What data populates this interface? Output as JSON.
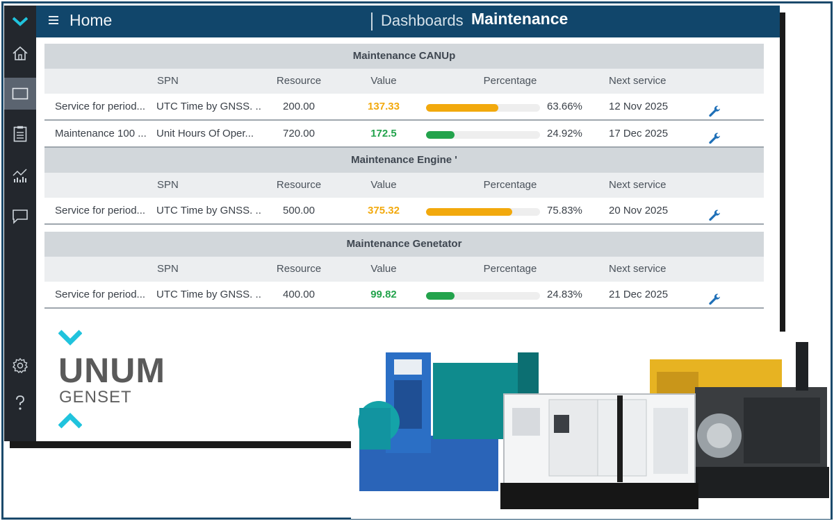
{
  "topbar": {
    "home": "Home",
    "dashboards": "Dashboards",
    "current": "Maintenance"
  },
  "columns": {
    "spn": "SPN",
    "resource": "Resource",
    "value": "Value",
    "percentage": "Percentage",
    "next_service": "Next service"
  },
  "sections": [
    {
      "title": "Maintenance CANUp",
      "rows": [
        {
          "name": "Service for period...",
          "spn": "UTC Time by GNSS. ...",
          "resource": "200.00",
          "value": "137.33",
          "value_status": "orange",
          "percent": 63.66,
          "percent_label": "63.66%",
          "next": "12 Nov 2025"
        },
        {
          "name": "Maintenance 100 ...",
          "spn": "Unit Hours Of Oper...",
          "resource": "720.00",
          "value": "172.5",
          "value_status": "green",
          "percent": 24.92,
          "percent_label": "24.92%",
          "next": "17 Dec 2025"
        }
      ]
    },
    {
      "title": "Maintenance Engine '",
      "rows": [
        {
          "name": "Service for period...",
          "spn": "UTC Time by GNSS. ...",
          "resource": "500.00",
          "value": "375.32",
          "value_status": "orange",
          "percent": 75.83,
          "percent_label": "75.83%",
          "next": "20 Nov 2025"
        }
      ]
    },
    {
      "title": "Maintenance Genetator",
      "rows": [
        {
          "name": "Service for period...",
          "spn": "UTC Time by GNSS. ...",
          "resource": "400.00",
          "value": "99.82",
          "value_status": "green",
          "percent": 24.83,
          "percent_label": "24.83%",
          "next": "21 Dec 2025"
        }
      ]
    }
  ],
  "logo": {
    "word": "UNUM",
    "sub": "GENSET"
  },
  "colors": {
    "topbar": "#11466b",
    "sidebar": "#23272d",
    "orange": "#f2a90d",
    "green": "#23a34c",
    "accent": "#20c3dd",
    "wrench": "#1f70b8"
  },
  "icons": {
    "sidebar": [
      "chevron-down-icon",
      "home-icon",
      "monitor-icon",
      "report-icon",
      "chart-icon",
      "chat-icon",
      "settings-icon",
      "help-icon"
    ],
    "row_action": "wrench-icon"
  }
}
